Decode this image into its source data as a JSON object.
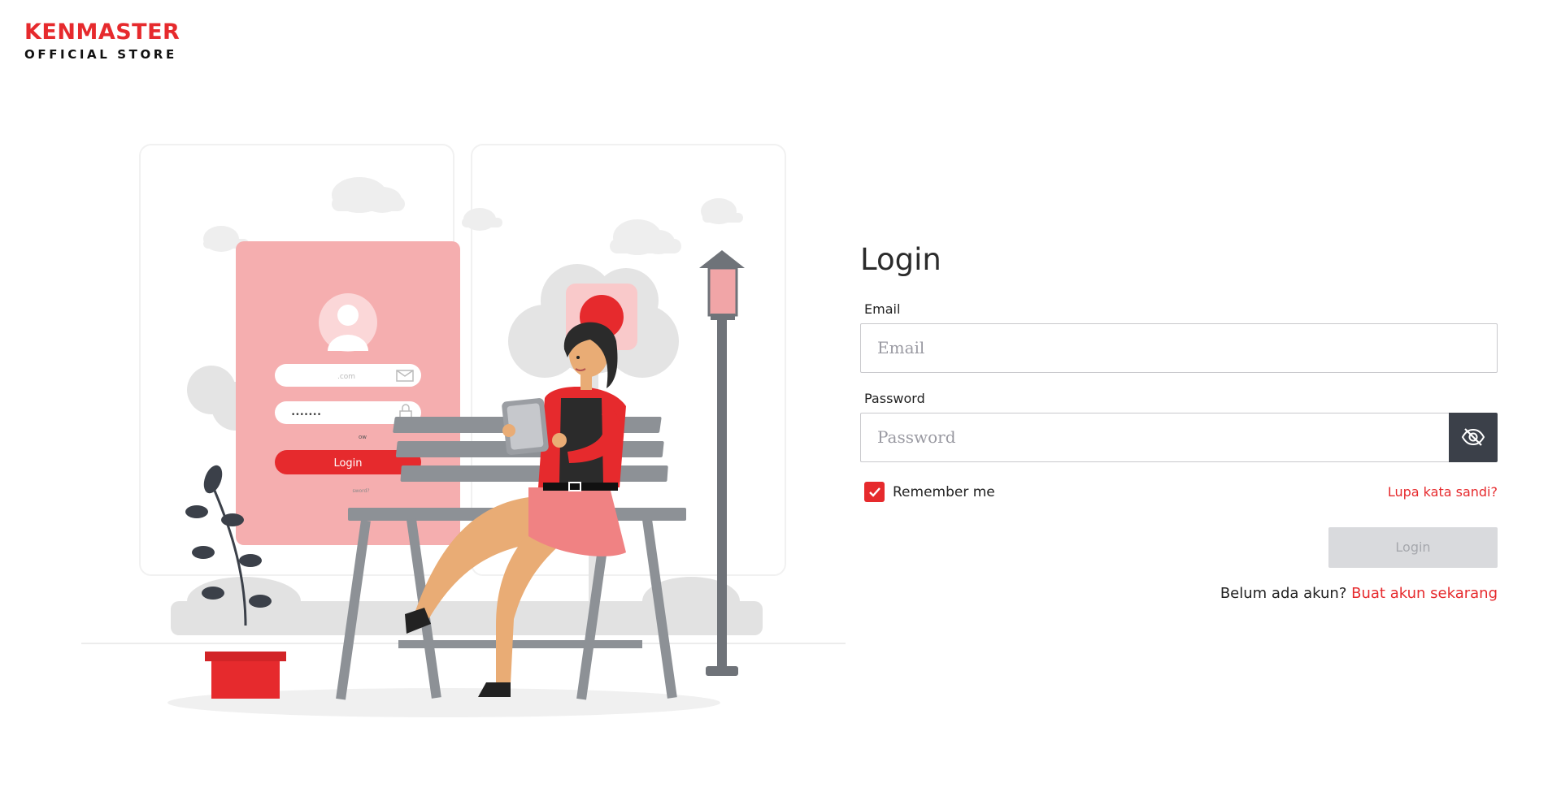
{
  "brand": {
    "name": "KENMASTER",
    "tagline": "OFFICIAL STORE",
    "accent_color": "#e62a2d"
  },
  "illustration": {
    "phone_email_text": ".com",
    "phone_password_text": "•••••••",
    "phone_small_text": "ow",
    "phone_login_label": "Login",
    "phone_forgot_text": "sword?"
  },
  "login": {
    "title": "Login",
    "email_label": "Email",
    "email_placeholder": "Email",
    "email_value": "",
    "password_label": "Password",
    "password_placeholder": "Password",
    "password_value": "",
    "password_toggle_icon": "eye-off-icon",
    "remember_label": "Remember me",
    "remember_checked": true,
    "forgot_label": "Lupa kata sandi?",
    "submit_label": "Login",
    "submit_disabled": true,
    "signup_prompt": "Belum ada akun?",
    "signup_link": "Buat akun sekarang"
  }
}
